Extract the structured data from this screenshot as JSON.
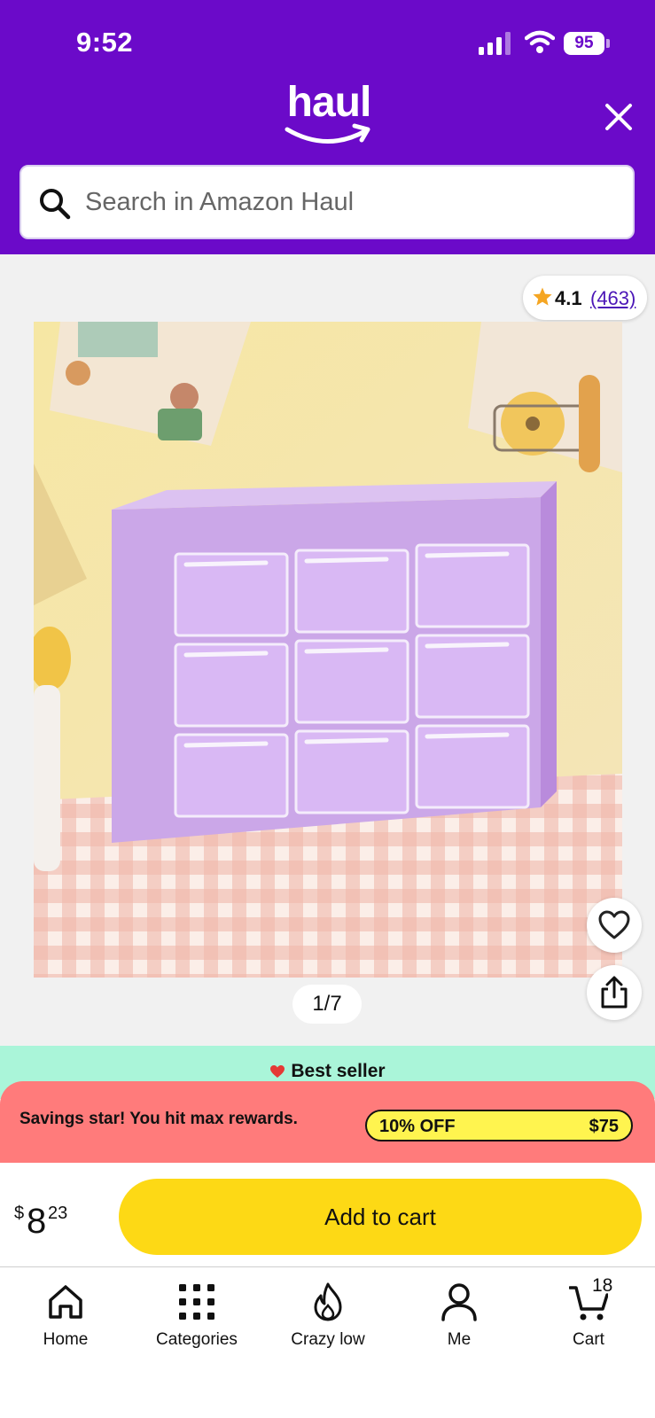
{
  "status_bar": {
    "time": "9:52",
    "battery": "95"
  },
  "header": {
    "logo": "haul",
    "search_placeholder": "Search in Amazon Haul"
  },
  "gallery": {
    "rating": "4.1",
    "rating_count": "(463)",
    "page_indicator": "1/7",
    "current_image": 1,
    "image_total": 7
  },
  "badge": {
    "best_seller": "Best seller"
  },
  "savings": {
    "message": "Savings star! You hit max rewards.",
    "discount": "10% OFF",
    "threshold": "$75"
  },
  "purchase": {
    "currency": "$",
    "price_whole": "8",
    "price_fraction": "23",
    "add_to_cart": "Add to cart"
  },
  "nav": {
    "items": [
      {
        "label": "Home",
        "icon": "home-icon"
      },
      {
        "label": "Categories",
        "icon": "categories-icon"
      },
      {
        "label": "Crazy low",
        "icon": "flame-icon"
      },
      {
        "label": "Me",
        "icon": "person-icon"
      },
      {
        "label": "Cart",
        "icon": "cart-icon"
      }
    ],
    "cart_count": "18"
  },
  "colors": {
    "brand": "#6b0ac9",
    "cta": "#fdd915",
    "best_seller_bg": "#aaf5d9",
    "savings_bg": "#ff7b7b",
    "savings_pill": "#fff44f"
  }
}
